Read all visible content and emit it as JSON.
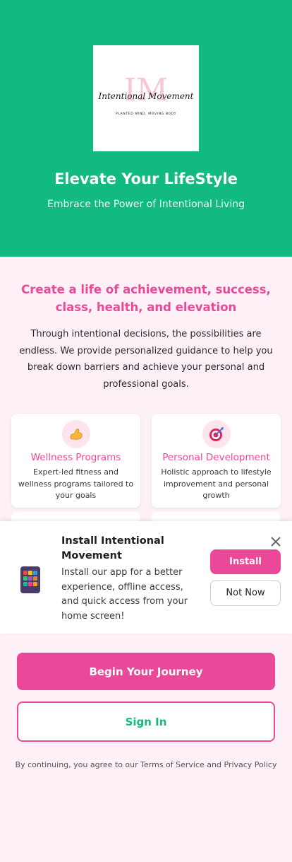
{
  "hero": {
    "logo": {
      "monogram": "IM",
      "script_name": "Intentional Movement",
      "tagline": "PLANTED MIND. MOVING BODY"
    },
    "title": "Elevate Your LifeStyle",
    "subtitle": "Embrace the Power of Intentional Living"
  },
  "intro": {
    "headline": "Create a life of achievement, success, class, health, and elevation",
    "body": "Through intentional decisions, the possibilities are endless. We provide personalized guidance to help you break down barriers and achieve your personal and professional goals."
  },
  "features": [
    {
      "icon": "flexed-biceps-icon",
      "title": "Wellness Programs",
      "description": "Expert-led fitness and wellness programs tailored to your goals"
    },
    {
      "icon": "target-icon",
      "title": "Personal Development",
      "description": "Holistic approach to lifestyle improvement and personal growth"
    }
  ],
  "install_banner": {
    "title": "Install Intentional Movement",
    "text": "Install our app for a better experience, offline access, and quick access from your home screen!",
    "install_label": "Install",
    "not_now_label": "Not Now"
  },
  "actions": {
    "begin_label": "Begin Your Journey",
    "sign_in_label": "Sign In"
  },
  "terms": "By continuing, you agree to our Terms of Service and Privacy Policy",
  "colors": {
    "primary_green": "#12b981",
    "accent_pink": "#ec4899",
    "background_pink": "#fdf0f6"
  }
}
